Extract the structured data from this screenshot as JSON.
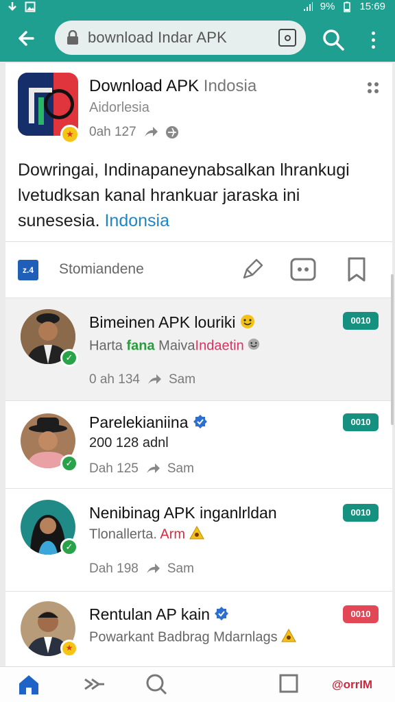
{
  "status_bar": {
    "battery": "9%",
    "time": "15:69"
  },
  "toolbar": {
    "url_text": "bownload Indar APK"
  },
  "app_card": {
    "title_strong": "Download APK",
    "title_light": "Indosia",
    "subtitle": "Aidorlesia",
    "meta": "0ah 127",
    "description": "Dowringai, Indinapaneynabsalkan lhrankugi lvetudksan kanal hrankuar jaraska ini sunesesia.",
    "description_link": "Indonsia",
    "action_label": "Stomiandene",
    "logo_text": "z.4"
  },
  "list": [
    {
      "title": "Bimeinen APK louriki",
      "sub_a": "Harta",
      "sub_b": "fana",
      "sub_c": "Maiva",
      "sub_d": "Indaetin",
      "meta": "0 ah 134",
      "meta_share": "Sam",
      "pill": "0010",
      "pill_color": "#16907f"
    },
    {
      "title": "Parelekianiina",
      "sub_a": "200 128 adnl",
      "meta": "Dah 125",
      "meta_share": "Sam",
      "pill": "0010",
      "pill_color": "#16907f"
    },
    {
      "title": "Nenibinag APK inganlrldan",
      "sub_a": "Tlonallerta.",
      "sub_d": "Arm",
      "meta": "Dah 198",
      "meta_share": "Sam",
      "pill": "0010",
      "pill_color": "#16907f"
    },
    {
      "title": "Rentulan AP kain",
      "sub_a": "Powarkant Badbrag Mdarnlags",
      "pill": "0010",
      "pill_color": "#e14755"
    }
  ],
  "bottom_nav": {
    "right_label": "@orrIM"
  },
  "colors": {
    "primary": "#1e9f90",
    "link": "#1e86c5",
    "verified_green": "#29a34a"
  }
}
